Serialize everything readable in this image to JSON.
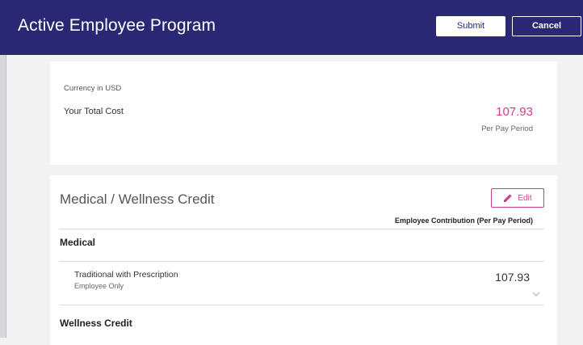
{
  "header": {
    "title": "Active Employee Program",
    "submit_label": "Submit",
    "cancel_label": "Cancel"
  },
  "cost_summary": {
    "currency_note": "Currency in USD",
    "total_label": "Your Total Cost",
    "total_value": "107.93",
    "period_label": "Per Pay Period"
  },
  "medical_section": {
    "title": "Medical / Wellness Credit",
    "edit_label": "Edit",
    "edit_icon": "pencil-icon",
    "column_header": "Employee Contribution (Per Pay Period)",
    "groups": [
      {
        "name": "Medical",
        "plans": [
          {
            "name": "Traditional with Prescription",
            "tier": "Employee Only",
            "cost": "107.93",
            "expand_icon": "chevron-down-icon"
          }
        ]
      },
      {
        "name": "Wellness Credit"
      }
    ]
  },
  "colors": {
    "header_bg": "#2a2874",
    "accent_pink": "#cc3d8a",
    "page_bg": "#f2f2f2"
  }
}
